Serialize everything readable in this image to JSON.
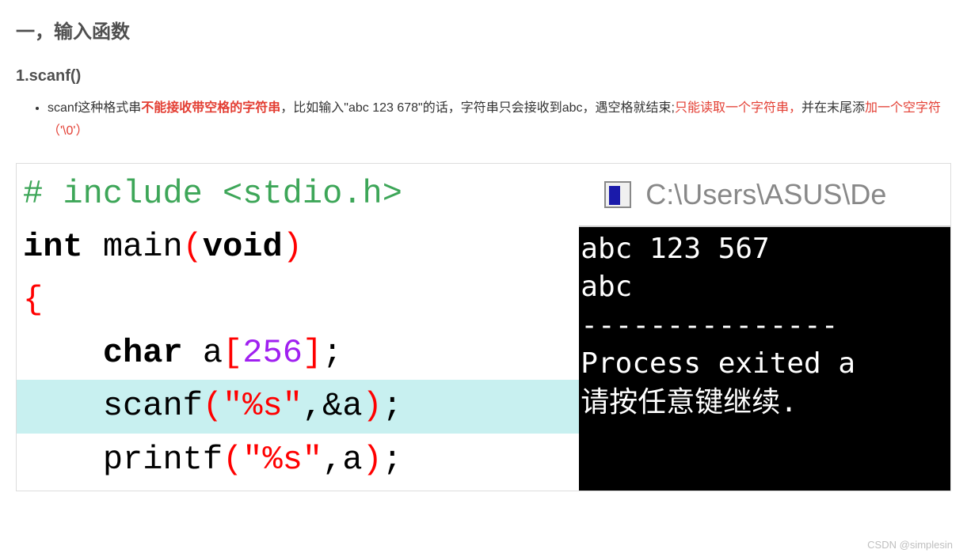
{
  "section": {
    "title": "一，输入函数",
    "sub_title": "1.scanf()"
  },
  "bullet": {
    "part1": "scanf这种格式串",
    "bold_red": "不能接收带空格的字符串",
    "part2": "，比如输入\"abc 123 678\"的话，字符串只会接收到abc，遇空格就结束;",
    "red1": "只能读取一个字符串，",
    "part3": "并在末尾添",
    "red2": "加一个空字符（'\\0'）"
  },
  "code": {
    "l1_preproc_hash": "# ",
    "l1_preproc_rest": "include <stdio.h>",
    "l2_kw1": "int",
    "l2_sp1": " main",
    "l2_p1": "(",
    "l2_kw2": "void",
    "l2_p2": ")",
    "l3_brace": "{",
    "l4_indent": "    ",
    "l4_kw": "char",
    "l4_sp": " a",
    "l4_b1": "[",
    "l4_num": "256",
    "l4_b2": "]",
    "l4_semi": ";",
    "l5_indent": "    ",
    "l5_fn": "scanf",
    "l5_p1": "(",
    "l5_str": "\"%s\"",
    "l5_comma": ",&a",
    "l5_p2": ")",
    "l5_semi": ";",
    "l6_indent": "    ",
    "l6_fn": "printf",
    "l6_p1": "(",
    "l6_str": "\"%s\"",
    "l6_comma": ",a",
    "l6_p2": ")",
    "l6_semi": ";"
  },
  "console": {
    "title": "C:\\Users\\ASUS\\De",
    "l1": "abc 123 567",
    "l2": "abc",
    "l3": "---------------",
    "l4": "Process exited a",
    "l5": "请按任意键继续."
  },
  "watermark": "CSDN @simplesin"
}
